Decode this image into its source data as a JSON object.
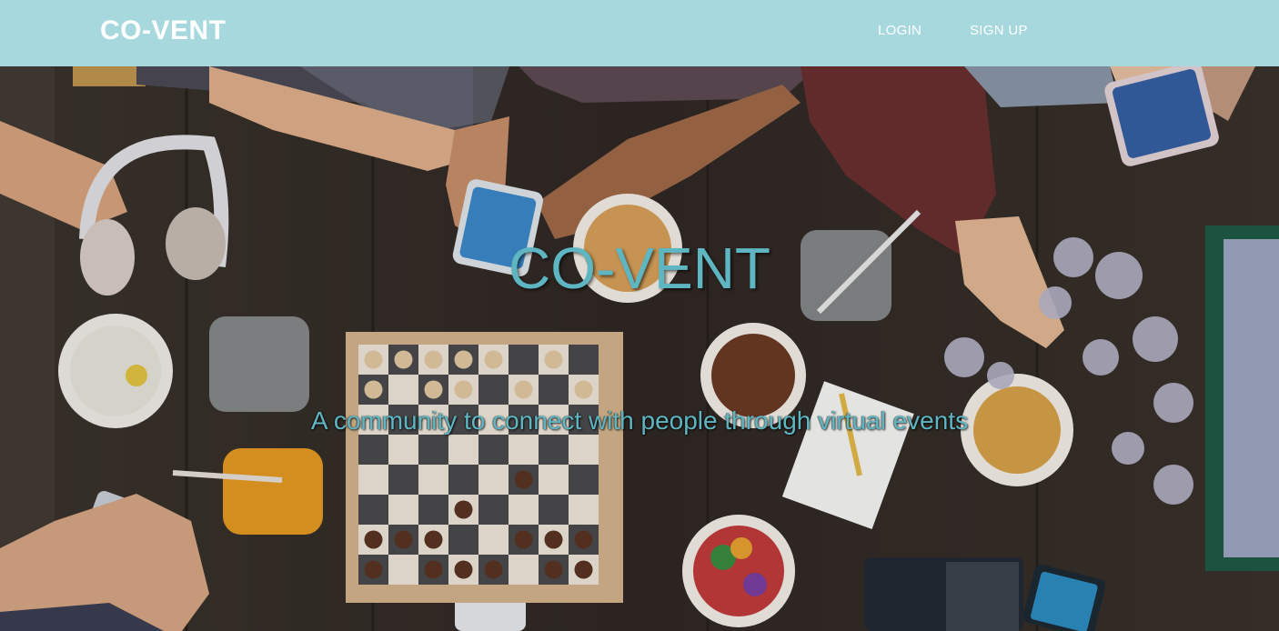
{
  "navbar": {
    "brand": "CO-VENT",
    "links": {
      "login": "LOGIN",
      "signup": "SIGN UP"
    },
    "background_color": "#a6d8de"
  },
  "hero": {
    "title": "CO-VENT",
    "subtitle": "A community to connect with people through virtual events",
    "accent_color": "#5fb6c3",
    "background_image": "photo-friends-playing-board-games-on-wooden-table"
  }
}
